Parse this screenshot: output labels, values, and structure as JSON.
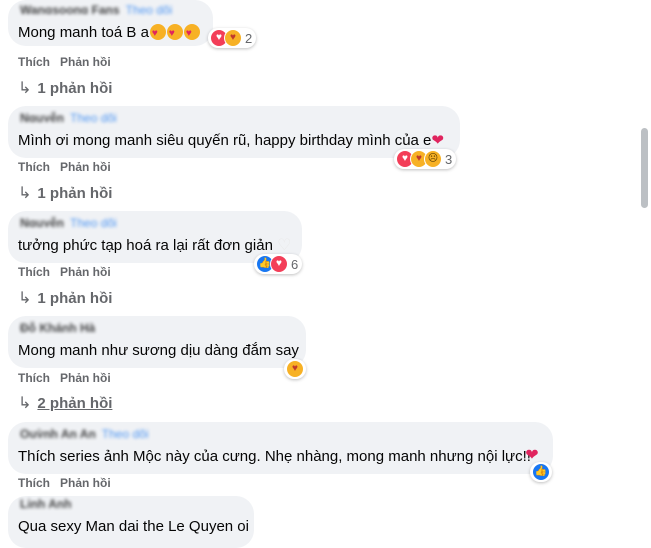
{
  "comments": [
    {
      "author": "Wangsoong Fans",
      "follow": "Theo dõi",
      "text": "Mong manh toá B a",
      "reaction_count": "2",
      "like": "Thích",
      "reply": "Phản hồi",
      "replies": "1 phản hồi"
    },
    {
      "author": "Nguyễn",
      "follow": "Theo dõi",
      "text": "Mình ơi mong manh siêu quyến rũ, happy birthday mình của e",
      "reaction_count": "3",
      "like": "Thích",
      "reply": "Phản hồi",
      "replies": "1 phản hồi"
    },
    {
      "author": "Nguyễn",
      "follow": "Theo dõi",
      "text": "tưởng phức tạp hoá ra lại rất đơn giản",
      "reaction_count": "6",
      "like": "Thích",
      "reply": "Phản hồi",
      "replies": "1 phản hồi"
    },
    {
      "author": "Đỗ Khánh Hà",
      "follow": "",
      "text": "Mong manh như sương dịu dàng đắm say",
      "reaction_count": "",
      "like": "Thích",
      "reply": "Phản hồi",
      "replies": "2 phản hồi"
    },
    {
      "author": "Quỳnh An An",
      "follow": "Theo dõi",
      "text": "Thích series ảnh Mộc này của cưng. Nhẹ nhàng, mong manh nhưng nội lực!!",
      "reaction_count": "",
      "like": "Thích",
      "reply": "Phản hồi",
      "replies": ""
    },
    {
      "author": "Linh Anh",
      "follow": "",
      "text": "Qua sexy Man dai the Le Quyen oi",
      "reaction_count": "",
      "like": "",
      "reply": "",
      "replies": ""
    }
  ],
  "icons": {
    "reply_arrow": "reply-arrow-icon",
    "love": "love-reaction-icon",
    "like": "like-reaction-icon",
    "care": "care-reaction-icon",
    "sad": "sad-reaction-icon"
  },
  "colors": {
    "bubble": "#f0f2f5",
    "secondary_text": "#65676b",
    "link": "#1877f2",
    "love": "#f33e58",
    "like": "#1877f2",
    "care": "#f7b125"
  }
}
